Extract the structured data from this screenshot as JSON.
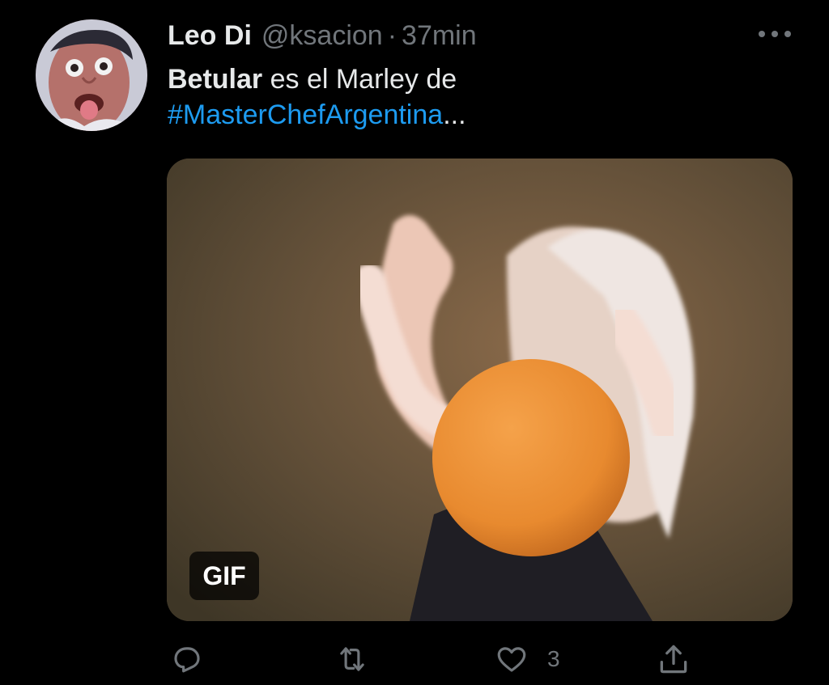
{
  "tweet": {
    "author": {
      "display_name": "Leo Di",
      "handle": "@ksacion"
    },
    "separator": "·",
    "time": "37min",
    "text": {
      "bold_word": "Betular",
      "rest": " es el Marley de",
      "hashtag": "#MasterChefArgentina",
      "ellipsis": "..."
    },
    "media": {
      "badge": "GIF"
    },
    "actions": {
      "reply_icon": "reply-icon",
      "retweet_icon": "retweet-icon",
      "like_icon": "heart-icon",
      "like_count": "3",
      "share_icon": "share-icon"
    },
    "colors": {
      "background": "#000000",
      "text": "#e7e9ea",
      "muted": "#71767b",
      "link": "#1d9bf0"
    }
  }
}
